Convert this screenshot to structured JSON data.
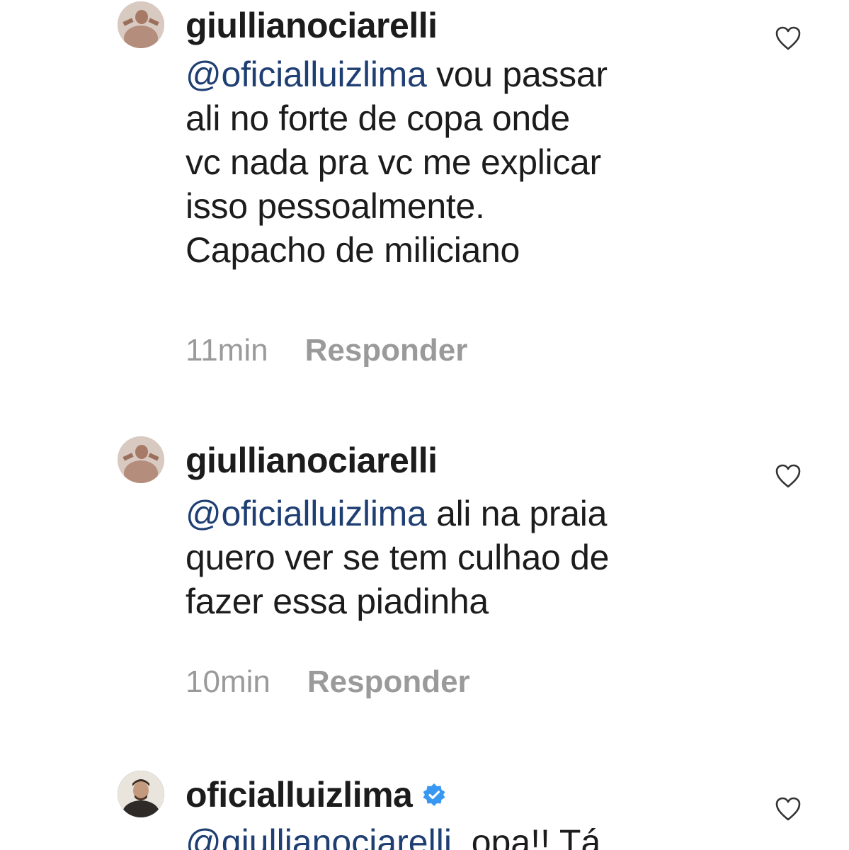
{
  "comments": [
    {
      "username": "giullianociarelli",
      "mention": "@oficialluizlima",
      "lines": [
        " vou passar",
        "ali no forte de copa onde",
        "vc nada pra vc me explicar",
        "isso pessoalmente.",
        "Capacho de miliciano"
      ],
      "time": "11min",
      "reply": "Responder",
      "avatar_icon": "profile-photo-avatar",
      "like_icon": "heart-outline-icon"
    },
    {
      "username": "giullianociarelli",
      "mention": "@oficialluizlima",
      "lines": [
        " ali na praia",
        "quero ver se tem culhao de",
        "fazer essa piadinha"
      ],
      "time": "10min",
      "reply": "Responder",
      "avatar_icon": "profile-photo-avatar",
      "like_icon": "heart-outline-icon"
    },
    {
      "username": "oficialluizlima",
      "verified": true,
      "verified_icon": "verified-badge-icon",
      "mention": "@giullianociarelli",
      "lines": [
        "  opa!! Tá"
      ],
      "avatar_icon": "profile-photo-avatar",
      "like_icon": "heart-outline-icon"
    }
  ],
  "colors": {
    "mention": "#1f3f73",
    "meta": "#9a9a9a",
    "text": "#1c1c1c",
    "verified": "#3897f0"
  }
}
